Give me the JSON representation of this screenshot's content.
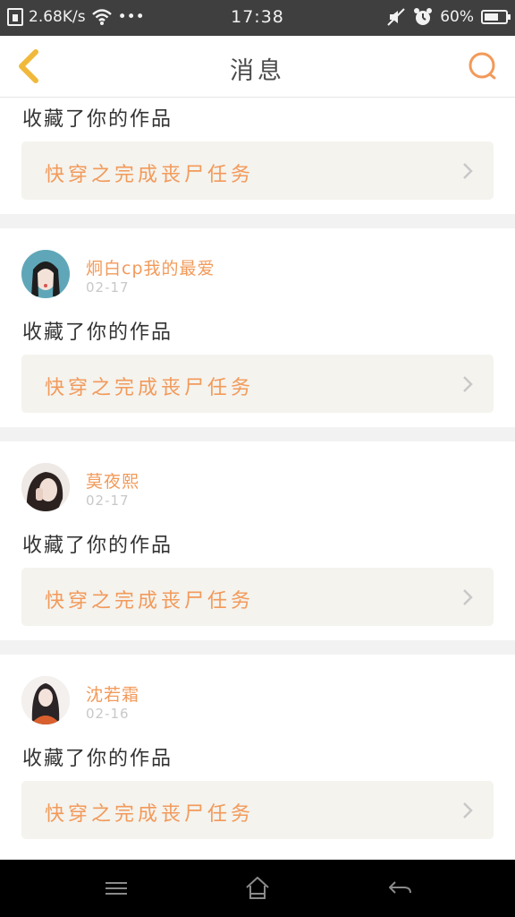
{
  "status_bar": {
    "speed": "2.68K/s",
    "dots": "•••",
    "time": "17:38",
    "battery": "60%"
  },
  "header": {
    "title": "消息"
  },
  "messages": [
    {
      "user": "",
      "date": "",
      "text": "收藏了你的作品",
      "work_title": "快穿之完成丧尸任务"
    },
    {
      "user": "炯白cp我的最爱",
      "date": "02-17",
      "text": "收藏了你的作品",
      "work_title": "快穿之完成丧尸任务"
    },
    {
      "user": "莫夜熙",
      "date": "02-17",
      "text": "收藏了你的作品",
      "work_title": "快穿之完成丧尸任务"
    },
    {
      "user": "沈若霜",
      "date": "02-16",
      "text": "收藏了你的作品",
      "work_title": "快穿之完成丧尸任务"
    }
  ],
  "colors": {
    "accent": "#f29a5a",
    "back_icon": "#f0b93a",
    "card_bg": "#f4f3ee",
    "divider": "#f2f2f2"
  },
  "icons": {
    "back": "chevron-left-icon",
    "search": "search-icon",
    "menu": "menu-icon",
    "home": "home-icon",
    "return": "return-icon"
  }
}
